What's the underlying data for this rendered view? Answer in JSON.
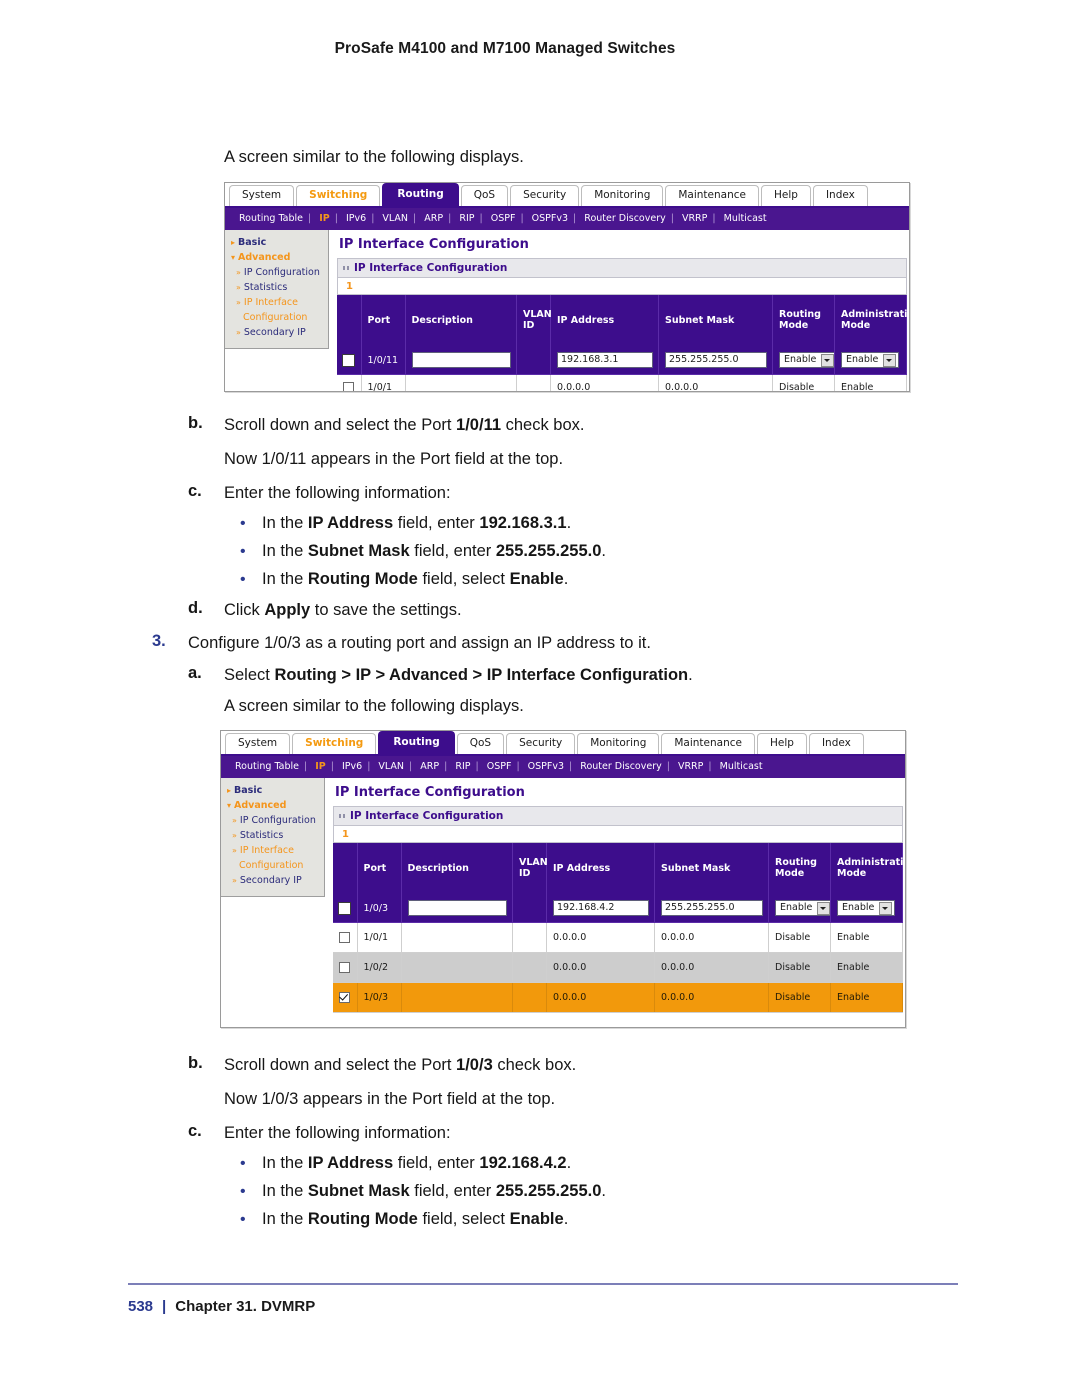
{
  "page": {
    "header": "ProSafe M4100 and M7100 Managed Switches",
    "footer_page_number": "538",
    "footer_separator": "|",
    "footer_chapter": "Chapter 31. DVMRP"
  },
  "body": {
    "intro_1": "A screen similar to the following displays.",
    "step2b": {
      "letter": "b.",
      "text_1": "Scroll down and select the Port ",
      "bold_1": "1/0/11",
      "text_2": " check box.",
      "note": "Now 1/0/11 appears in the Port field at the top."
    },
    "step2c": {
      "letter": "c.",
      "text": "Enter the following information:",
      "bullets": [
        {
          "pre": "In the ",
          "bold": "IP Address",
          "mid": " field, enter ",
          "boldval": "192.168.3.1",
          "post": "."
        },
        {
          "pre": "In the ",
          "bold": "Subnet Mask",
          "mid": " field, enter ",
          "boldval": "255.255.255.0",
          "post": "."
        },
        {
          "pre": "In the ",
          "bold": "Routing Mode",
          "mid": " field, select ",
          "boldval": "Enable",
          "post": "."
        }
      ]
    },
    "step2d": {
      "letter": "d.",
      "pre": "Click ",
      "bold": "Apply",
      "post": " to save the settings."
    },
    "step3": {
      "number": "3.",
      "text": "Configure 1/0/3 as a routing port and assign an IP address to it."
    },
    "step3a": {
      "letter": "a.",
      "pre": "Select ",
      "bold": "Routing > IP > Advanced > IP Interface Configuration",
      "post": "."
    },
    "intro_2": "A screen similar to the following displays.",
    "step3b": {
      "letter": "b.",
      "text_1": "Scroll down and select the Port ",
      "bold_1": "1/0/3",
      "text_2": " check box.",
      "note": "Now 1/0/3 appears in the Port field at the top."
    },
    "step3c": {
      "letter": "c.",
      "text": "Enter the following information:",
      "bullets": [
        {
          "pre": "In the ",
          "bold": "IP Address",
          "mid": " field, enter ",
          "boldval": "192.168.4.2",
          "post": "."
        },
        {
          "pre": "In the ",
          "bold": "Subnet Mask",
          "mid": " field, enter ",
          "boldval": "255.255.255.0",
          "post": "."
        },
        {
          "pre": "In the ",
          "bold": "Routing Mode",
          "mid": " field, select ",
          "boldval": "Enable",
          "post": "."
        }
      ]
    }
  },
  "ui": {
    "tabs": [
      {
        "label": "System",
        "state": "normal"
      },
      {
        "label": "Switching",
        "state": "orange"
      },
      {
        "label": "Routing",
        "state": "active"
      },
      {
        "label": "QoS",
        "state": "normal"
      },
      {
        "label": "Security",
        "state": "normal"
      },
      {
        "label": "Monitoring",
        "state": "normal"
      },
      {
        "label": "Maintenance",
        "state": "normal"
      },
      {
        "label": "Help",
        "state": "normal"
      },
      {
        "label": "Index",
        "state": "normal"
      }
    ],
    "subnav": [
      {
        "label": "Routing Table",
        "selected": false
      },
      {
        "label": "IP",
        "selected": true
      },
      {
        "label": "IPv6",
        "selected": false
      },
      {
        "label": "VLAN",
        "selected": false
      },
      {
        "label": "ARP",
        "selected": false
      },
      {
        "label": "RIP",
        "selected": false
      },
      {
        "label": "OSPF",
        "selected": false
      },
      {
        "label": "OSPFv3",
        "selected": false
      },
      {
        "label": "Router Discovery",
        "selected": false
      },
      {
        "label": "VRRP",
        "selected": false
      },
      {
        "label": "Multicast",
        "selected": false
      }
    ],
    "sidebar": [
      {
        "label": "Basic",
        "type": "top"
      },
      {
        "label": "Advanced",
        "type": "adv"
      },
      {
        "label": "IP Configuration",
        "type": "sub"
      },
      {
        "label": "Statistics",
        "type": "sub"
      },
      {
        "label": "IP Interface",
        "type": "sub-hl"
      },
      {
        "label": "Configuration",
        "type": "cont"
      },
      {
        "label": "Secondary IP",
        "type": "sub"
      }
    ],
    "panel_title": "IP Interface Configuration",
    "section_bar": "IP Interface Configuration",
    "pager": "1",
    "columns": [
      "",
      "Port",
      "Description",
      "VLAN ID",
      "IP Address",
      "Subnet Mask",
      "Routing Mode",
      "Administrative Mode"
    ],
    "columns_split": [
      {
        "line1": "",
        "line2": ""
      },
      {
        "line1": "Port",
        "line2": ""
      },
      {
        "line1": "Description",
        "line2": ""
      },
      {
        "line1": "VLAN",
        "line2": "ID"
      },
      {
        "line1": "IP Address",
        "line2": ""
      },
      {
        "line1": "Subnet Mask",
        "line2": ""
      },
      {
        "line1": "Routing",
        "line2": "Mode"
      },
      {
        "line1": "Administrative",
        "line2": "Mode"
      }
    ],
    "dropdown_value": "Enable",
    "screen1": {
      "edit_row": {
        "port": "1/0/11",
        "description": "",
        "vlan_id": "",
        "ip_address": "192.168.3.1",
        "subnet_mask": "255.255.255.0",
        "routing_mode": "Enable",
        "admin_mode": "Enable",
        "checked": false
      },
      "rows": [
        {
          "port": "1/0/1",
          "description": "",
          "vlan_id": "",
          "ip_address": "0.0.0.0",
          "subnet_mask": "0.0.0.0",
          "routing_mode": "Disable",
          "admin_mode": "Enable",
          "checked": false,
          "style": "white"
        }
      ]
    },
    "screen2": {
      "edit_row": {
        "port": "1/0/3",
        "description": "",
        "vlan_id": "",
        "ip_address": "192.168.4.2",
        "subnet_mask": "255.255.255.0",
        "routing_mode": "Enable",
        "admin_mode": "Enable",
        "checked": false
      },
      "rows": [
        {
          "port": "1/0/1",
          "description": "",
          "vlan_id": "",
          "ip_address": "0.0.0.0",
          "subnet_mask": "0.0.0.0",
          "routing_mode": "Disable",
          "admin_mode": "Enable",
          "checked": false,
          "style": "white"
        },
        {
          "port": "1/0/2",
          "description": "",
          "vlan_id": "",
          "ip_address": "0.0.0.0",
          "subnet_mask": "0.0.0.0",
          "routing_mode": "Disable",
          "admin_mode": "Enable",
          "checked": false,
          "style": "gray"
        },
        {
          "port": "1/0/3",
          "description": "",
          "vlan_id": "",
          "ip_address": "0.0.0.0",
          "subnet_mask": "0.0.0.0",
          "routing_mode": "Disable",
          "admin_mode": "Enable",
          "checked": true,
          "style": "selected"
        }
      ]
    }
  },
  "colors": {
    "brand_purple": "#3d0d8c",
    "subnav_purple": "#4a168f",
    "accent_orange": "#f4951c",
    "selected_row": "#f2990c",
    "step_blue": "#2b3a8f"
  }
}
